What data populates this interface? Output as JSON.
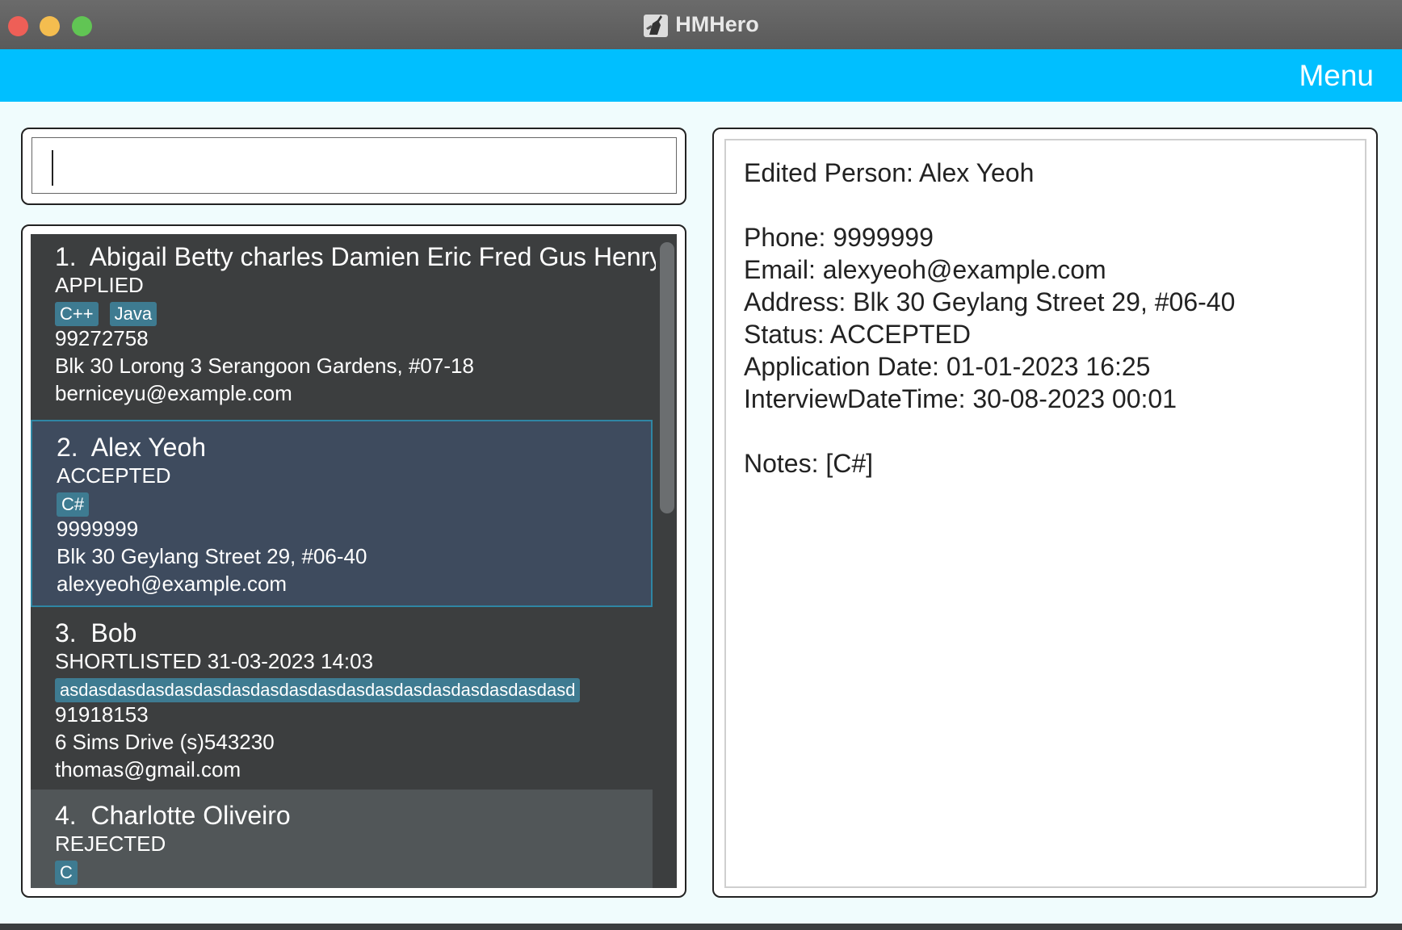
{
  "window": {
    "title": "HMHero"
  },
  "menubar": {
    "menu_label": "Menu"
  },
  "command": {
    "value": "",
    "placeholder": ""
  },
  "persons": [
    {
      "index": "1.",
      "name": "Abigail Betty charles Damien Eric Fred Gus Henry ...",
      "status": "APPLIED",
      "tags": [
        "C++",
        "Java"
      ],
      "phone": "99272758",
      "address": "Blk 30 Lorong 3 Serangoon Gardens, #07-18",
      "email": "berniceyu@example.com"
    },
    {
      "index": "2.",
      "name": "Alex Yeoh",
      "status": "ACCEPTED",
      "tags": [
        "C#"
      ],
      "phone": "9999999",
      "address": "Blk 30 Geylang Street 29, #06-40",
      "email": "alexyeoh@example.com"
    },
    {
      "index": "3.",
      "name": "Bob",
      "status": "SHORTLISTED 31-03-2023 14:03",
      "tags": [
        "asdasdasdasdasdasdasdasdasdasdasdasdasdasdasdasdasdasd"
      ],
      "phone": "91918153",
      "address": "6 Sims Drive (s)543230",
      "email": "thomas@gmail.com"
    },
    {
      "index": "4.",
      "name": "Charlotte Oliveiro",
      "status": "REJECTED",
      "tags": [
        "C"
      ]
    }
  ],
  "result": {
    "edited": "Edited Person: Alex Yeoh",
    "phone": "Phone: 9999999",
    "email": "Email: alexyeoh@example.com",
    "address": "Address: Blk 30 Geylang Street 29, #06-40",
    "status": "Status: ACCEPTED",
    "application_date": "Application Date: 01-01-2023 16:25",
    "interview": "InterviewDateTime: 30-08-2023 00:01",
    "notes": "Notes: [C#]"
  },
  "colors": {
    "menubar": "#00bfff",
    "background": "#f0fcfd",
    "list_bg": "#3c3e3f",
    "selected_card": "#3e4b5e",
    "tag": "#3e7b91"
  },
  "icons": {
    "app": "hmhero-app-icon"
  }
}
